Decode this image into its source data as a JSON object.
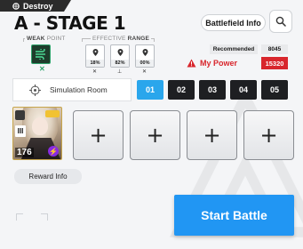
{
  "header": {
    "destroy_label": "Destroy",
    "stage_title": "A - STAGE 1",
    "battlefield_info_label": "Battlefield Info"
  },
  "weak_point": {
    "label_weak": "WEAK",
    "label_point": "POINT",
    "mark": "✕"
  },
  "effective_range": {
    "label_effective": "EFFECTIVE",
    "label_range": "RANGE",
    "cards": [
      {
        "value": "18%",
        "mark": "✕"
      },
      {
        "value": "82%",
        "mark": "⊥"
      },
      {
        "value": "00%",
        "mark": "✕"
      }
    ]
  },
  "power": {
    "recommended_label": "Recommended",
    "recommended_value": "8045",
    "my_power_label": "My Power",
    "my_power_value": "15320",
    "alert_color": "#d8262c"
  },
  "simulation_room": {
    "label": "Simulation Room"
  },
  "teams": {
    "tabs": [
      "01",
      "02",
      "03",
      "04",
      "05"
    ],
    "active_index": 0
  },
  "squad": {
    "slot1": {
      "burst": "III",
      "level": "176",
      "element_icon": "lightning-icon"
    },
    "empty_slot_symbol": "+"
  },
  "footer": {
    "reward_info_label": "Reward Info",
    "start_battle_label": "Start Battle"
  },
  "colors": {
    "accent": "#2aa6ec",
    "start_button": "#2196f3",
    "weak_point_green": "#2ea36b"
  }
}
